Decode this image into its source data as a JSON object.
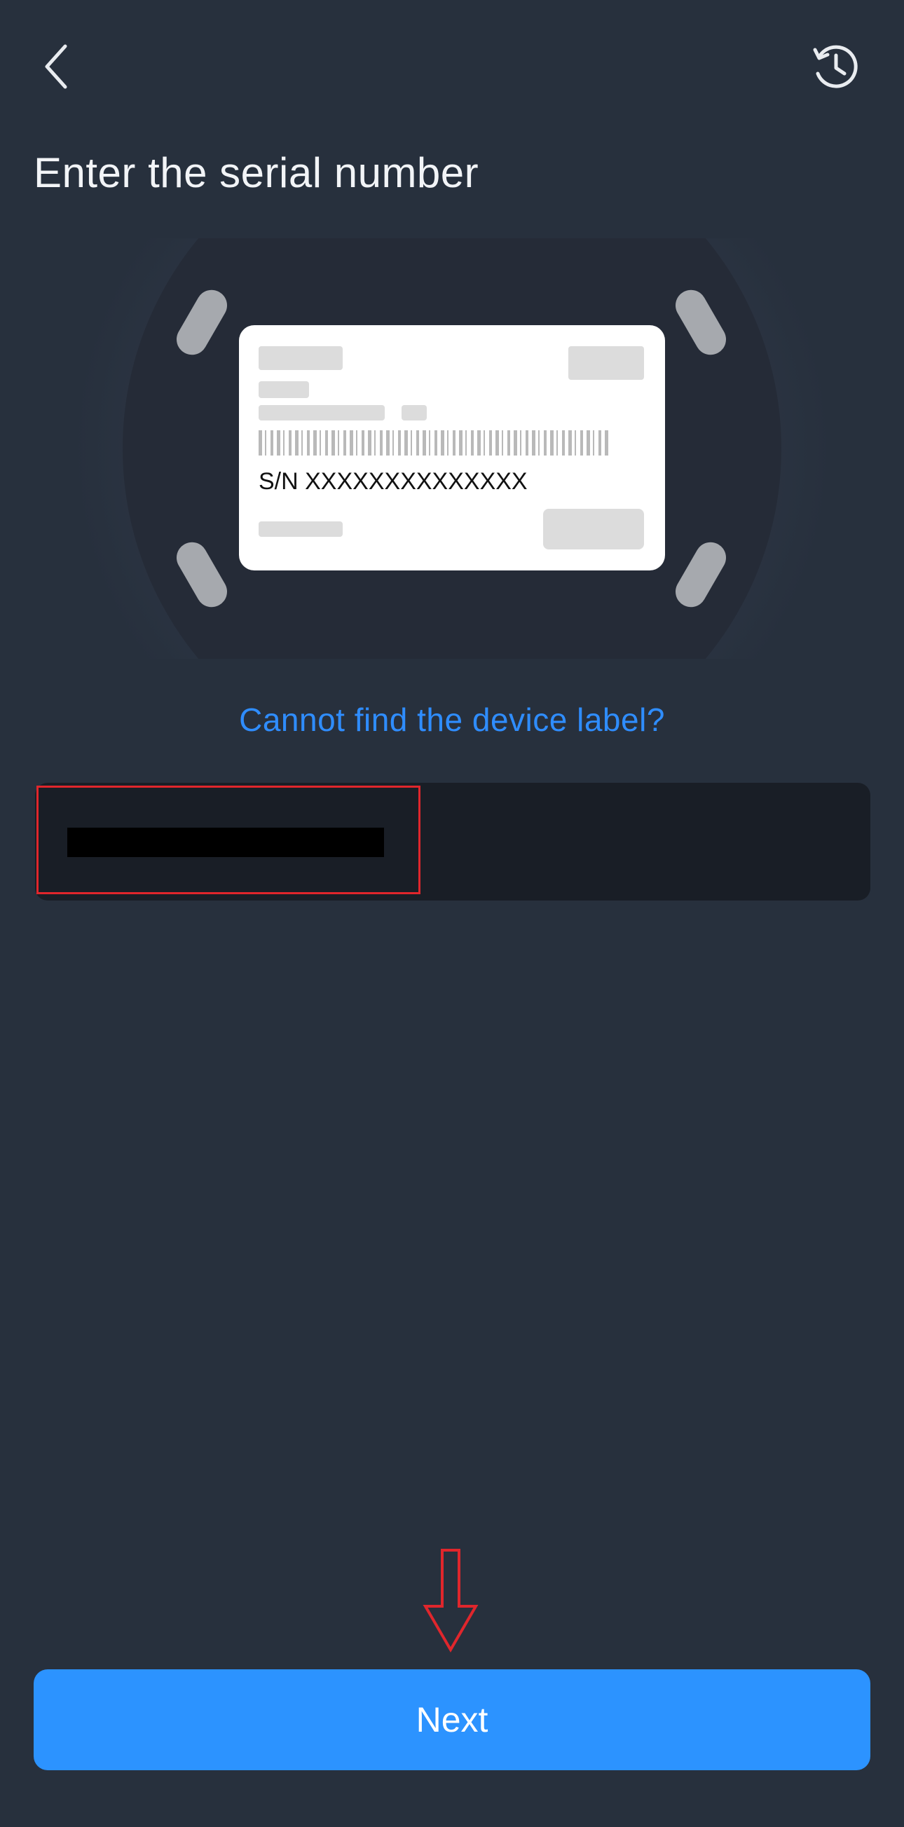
{
  "header": {
    "back_icon": "chevron-left-icon",
    "history_icon": "history-clock-icon",
    "title": "Enter the serial number"
  },
  "illustration": {
    "serial_label_text": "S/N XXXXXXXXXXXXXX"
  },
  "help": {
    "link_text": "Cannot find the device label?"
  },
  "serial_input": {
    "value": "",
    "placeholder": ""
  },
  "footer": {
    "next_label": "Next"
  },
  "colors": {
    "background": "#27303d",
    "accent": "#2c93ff",
    "link": "#2f8dff",
    "annotation_red": "#e0262c",
    "input_bg": "#191e26"
  }
}
